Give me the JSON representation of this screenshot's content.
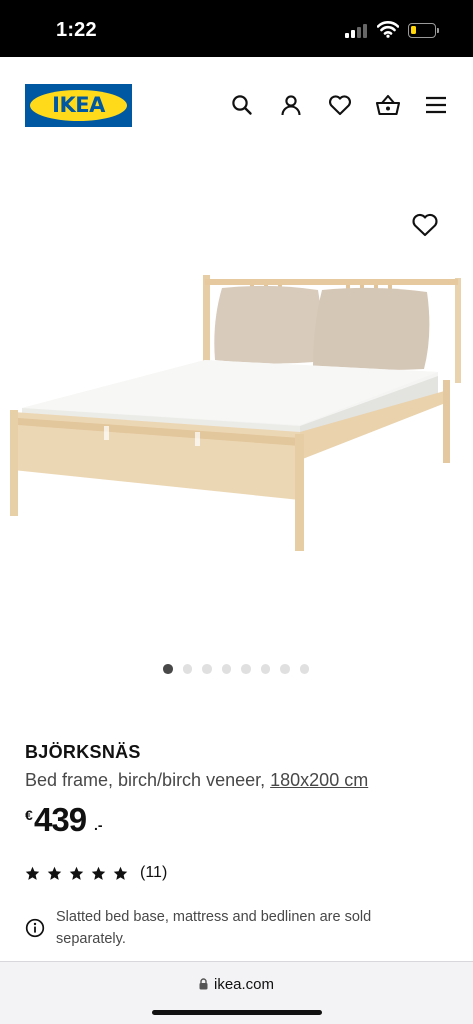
{
  "status_bar": {
    "time": "1:22"
  },
  "header": {
    "logo_text": "IKEA",
    "brand_colors": {
      "blue": "#0058a3",
      "yellow": "#ffda1a"
    },
    "icons": [
      "search-icon",
      "account-icon",
      "favourites-icon",
      "shopping-bag-icon",
      "menu-icon"
    ]
  },
  "hero": {
    "image_count": 8,
    "active_image": 1
  },
  "product": {
    "name": "BJÖRKSNÄS",
    "description": "Bed frame, birch/birch veneer,",
    "size": "180x200 cm",
    "price_currency": "€",
    "price_amount": "439",
    "price_decimals": ".-",
    "rating_stars": 5,
    "rating_count": "(11)",
    "info_note": "Slatted bed base, mattress and bedlinen are sold separately."
  },
  "browser": {
    "url": "ikea.com"
  }
}
